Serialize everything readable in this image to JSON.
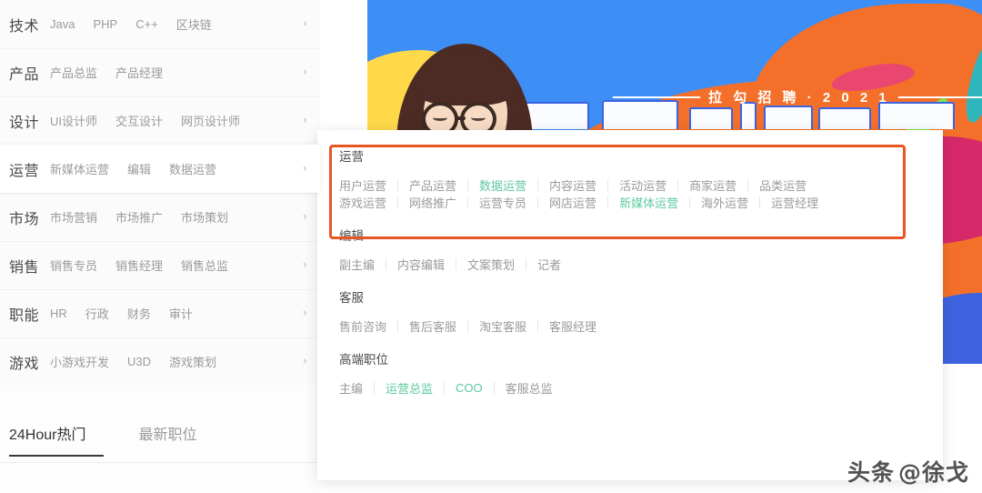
{
  "colors": {
    "accent_green": "#5ec9a0",
    "annotation_red": "#ea5524",
    "banner_blue": "#3d8ef5",
    "banner_orange": "#f4702a",
    "banner_magenta": "#d6296a",
    "banner_yellow": "#ffd94a",
    "text_dark": "#4a4a4a",
    "text_muted": "#9b9b9b"
  },
  "banner": {
    "title": "拉 勾 招 聘 · 2 0 2 1",
    "alt": "recruiting-banner-illustration-woman-with-glasses"
  },
  "sidebar": {
    "categories": [
      {
        "name": "技术",
        "subs": [
          "Java",
          "PHP",
          "C++",
          "区块链"
        ],
        "chevron": "›",
        "hovered": false
      },
      {
        "name": "产品",
        "subs": [
          "产品总监",
          "产品经理"
        ],
        "chevron": "›",
        "hovered": false
      },
      {
        "name": "设计",
        "subs": [
          "UI设计师",
          "交互设计",
          "网页设计师"
        ],
        "chevron": "›",
        "hovered": false
      },
      {
        "name": "运营",
        "subs": [
          "新媒体运营",
          "编辑",
          "数据运营"
        ],
        "chevron": "›",
        "hovered": true
      },
      {
        "name": "市场",
        "subs": [
          "市场营销",
          "市场推广",
          "市场策划"
        ],
        "chevron": "›",
        "hovered": false
      },
      {
        "name": "销售",
        "subs": [
          "销售专员",
          "销售经理",
          "销售总监"
        ],
        "chevron": "›",
        "hovered": false
      },
      {
        "name": "职能",
        "subs": [
          "HR",
          "行政",
          "财务",
          "审计"
        ],
        "chevron": "›",
        "hovered": false
      },
      {
        "name": "游戏",
        "subs": [
          "小游戏开发",
          "U3D",
          "游戏策划"
        ],
        "chevron": "›",
        "hovered": false
      }
    ],
    "tabs": [
      {
        "label": "24Hour热门",
        "active": true
      },
      {
        "label": "最新职位",
        "active": false
      }
    ]
  },
  "panel": {
    "groups": [
      {
        "title": "运营",
        "rows": [
          [
            {
              "label": "用户运营",
              "highlighted": false
            },
            {
              "label": "产品运营",
              "highlighted": false
            },
            {
              "label": "数据运营",
              "highlighted": true
            },
            {
              "label": "内容运营",
              "highlighted": false
            },
            {
              "label": "活动运营",
              "highlighted": false
            },
            {
              "label": "商家运营",
              "highlighted": false
            },
            {
              "label": "品类运营",
              "highlighted": false
            }
          ],
          [
            {
              "label": "游戏运营",
              "highlighted": false
            },
            {
              "label": "网络推广",
              "highlighted": false
            },
            {
              "label": "运营专员",
              "highlighted": false
            },
            {
              "label": "网店运营",
              "highlighted": false
            },
            {
              "label": "新媒体运营",
              "highlighted": true
            },
            {
              "label": "海外运营",
              "highlighted": false
            },
            {
              "label": "运营经理",
              "highlighted": false
            }
          ]
        ]
      },
      {
        "title": "编辑",
        "rows": [
          [
            {
              "label": "副主编",
              "highlighted": false
            },
            {
              "label": "内容编辑",
              "highlighted": false
            },
            {
              "label": "文案策划",
              "highlighted": false
            },
            {
              "label": "记者",
              "highlighted": false
            }
          ]
        ]
      },
      {
        "title": "客服",
        "rows": [
          [
            {
              "label": "售前咨询",
              "highlighted": false
            },
            {
              "label": "售后客服",
              "highlighted": false
            },
            {
              "label": "淘宝客服",
              "highlighted": false
            },
            {
              "label": "客服经理",
              "highlighted": false
            }
          ]
        ]
      },
      {
        "title": "高端职位",
        "rows": [
          [
            {
              "label": "主编",
              "highlighted": false
            },
            {
              "label": "运营总监",
              "highlighted": true
            },
            {
              "label": "COO",
              "highlighted": true
            },
            {
              "label": "客服总监",
              "highlighted": false
            }
          ]
        ]
      }
    ]
  },
  "watermark": {
    "prefix": "头条",
    "handle": "@徐戈"
  }
}
